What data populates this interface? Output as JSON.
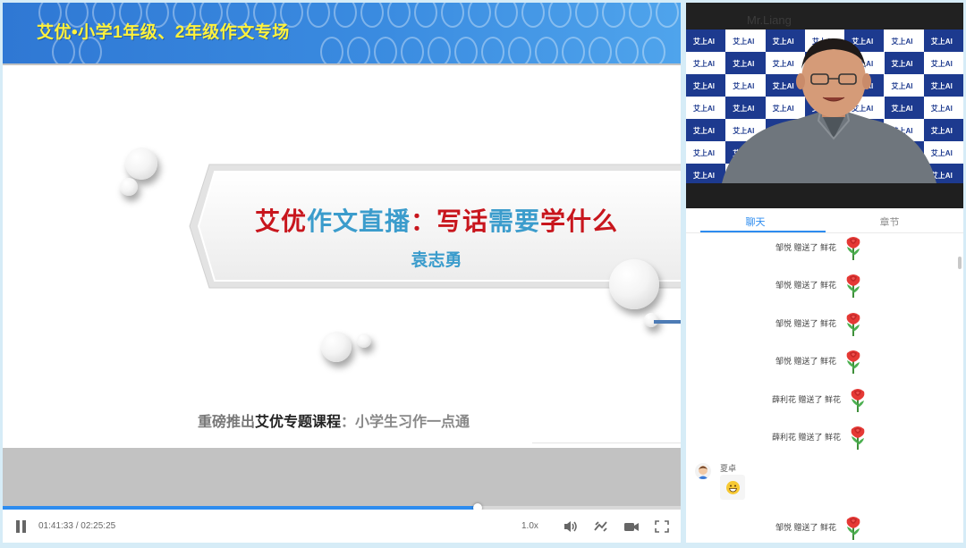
{
  "slide": {
    "banner_title": "艾优•小学1年级、2年级作文专场",
    "title_parts": [
      {
        "text": "艾优",
        "color": "#c8161d"
      },
      {
        "text": "作文直播",
        "color": "#3b9ccc"
      },
      {
        "text": "：写话",
        "color": "#c8161d"
      },
      {
        "text": "需要",
        "color": "#3b9ccc"
      },
      {
        "text": "学什么",
        "color": "#c8161d"
      }
    ],
    "author": "袁志勇",
    "promo_prefix": "重磅推出",
    "promo_key": "艾优专题课程",
    "promo_suffix": "：小学生习作一点通"
  },
  "player": {
    "time": "01:41:33 / 02:25:25",
    "speed": "1.0x",
    "progress": 0.7,
    "accent": "#2d8cf0",
    "icons": [
      "pause-icon",
      "volume-icon",
      "switch-line-icon",
      "camera-icon",
      "fullscreen-icon"
    ]
  },
  "camera": {
    "name": "Mr.Liang",
    "logo_text": "艾上AI"
  },
  "tabs": {
    "chat": "聊天",
    "chapters": "章节"
  },
  "chat": {
    "messages": [
      {
        "type": "gift",
        "text": "邹悦 赠送了 鲜花"
      },
      {
        "type": "gift",
        "text": "邹悦 赠送了 鲜花"
      },
      {
        "type": "gift",
        "text": "邹悦 赠送了 鲜花"
      },
      {
        "type": "gift",
        "text": "邹悦 赠送了 鲜花"
      },
      {
        "type": "gift",
        "text": "薛利花 赠送了 鲜花"
      },
      {
        "type": "gift",
        "text": "薛利花 赠送了 鲜花"
      }
    ],
    "user_message": {
      "user": "夏卓",
      "content": "grinning-emoji"
    },
    "last_gift": "邹悦 赠送了 鲜花"
  }
}
